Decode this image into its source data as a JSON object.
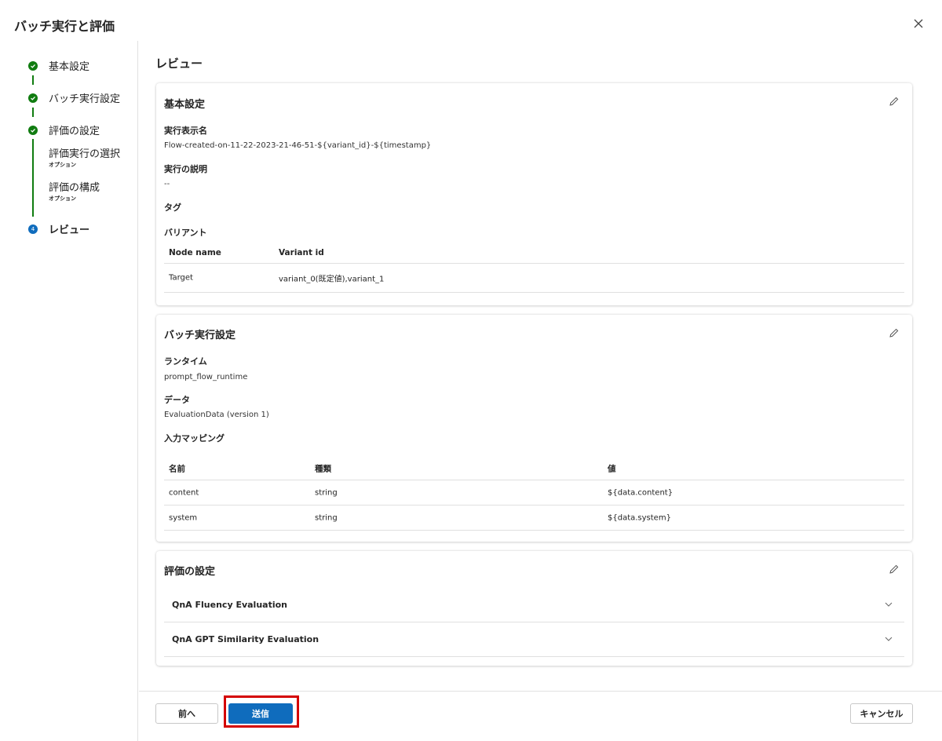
{
  "dialog": {
    "title": "バッチ実行と評価"
  },
  "steps": [
    {
      "label": "基本設定",
      "status": "completed"
    },
    {
      "label": "バッチ実行設定",
      "status": "completed"
    },
    {
      "label": "評価の設定",
      "status": "completed"
    },
    {
      "label": "評価実行の選択",
      "sublabel": "オプション"
    },
    {
      "label": "評価の構成",
      "sublabel": "オプション"
    },
    {
      "label": "レビュー",
      "status": "current",
      "number": "4"
    }
  ],
  "review": {
    "title": "レビュー",
    "basic": {
      "title": "基本設定",
      "display_name_label": "実行表示名",
      "display_name": "Flow-created-on-11-22-2023-21-46-51-${variant_id}-${timestamp}",
      "description_label": "実行の説明",
      "description": "--",
      "tags_label": "タグ",
      "variants_label": "バリアント",
      "variants_table": {
        "headers": [
          "Node name",
          "Variant id"
        ],
        "rows": [
          [
            "Target",
            "variant_0(既定値),variant_1"
          ]
        ]
      }
    },
    "batch": {
      "title": "バッチ実行設定",
      "runtime_label": "ランタイム",
      "runtime": "prompt_flow_runtime",
      "data_label": "データ",
      "data": "EvaluationData (version 1)",
      "mapping_label": "入力マッピング",
      "mapping_table": {
        "headers": [
          "名前",
          "種類",
          "値"
        ],
        "rows": [
          [
            "content",
            "string",
            "${data.content}"
          ],
          [
            "system",
            "string",
            "${data.system}"
          ]
        ]
      }
    },
    "eval": {
      "title": "評価の設定",
      "items": [
        "QnA Fluency Evaluation",
        "QnA GPT Similarity Evaluation"
      ]
    }
  },
  "footer": {
    "back_label": "前へ",
    "submit_label": "送信",
    "cancel_label": "キャンセル"
  },
  "colors": {
    "accent": "#0f6cbd",
    "success": "#107c10",
    "highlight": "#d40000"
  },
  "icons": [
    "close-icon",
    "check-circle-icon",
    "pencil-icon",
    "chevron-down-icon"
  ]
}
